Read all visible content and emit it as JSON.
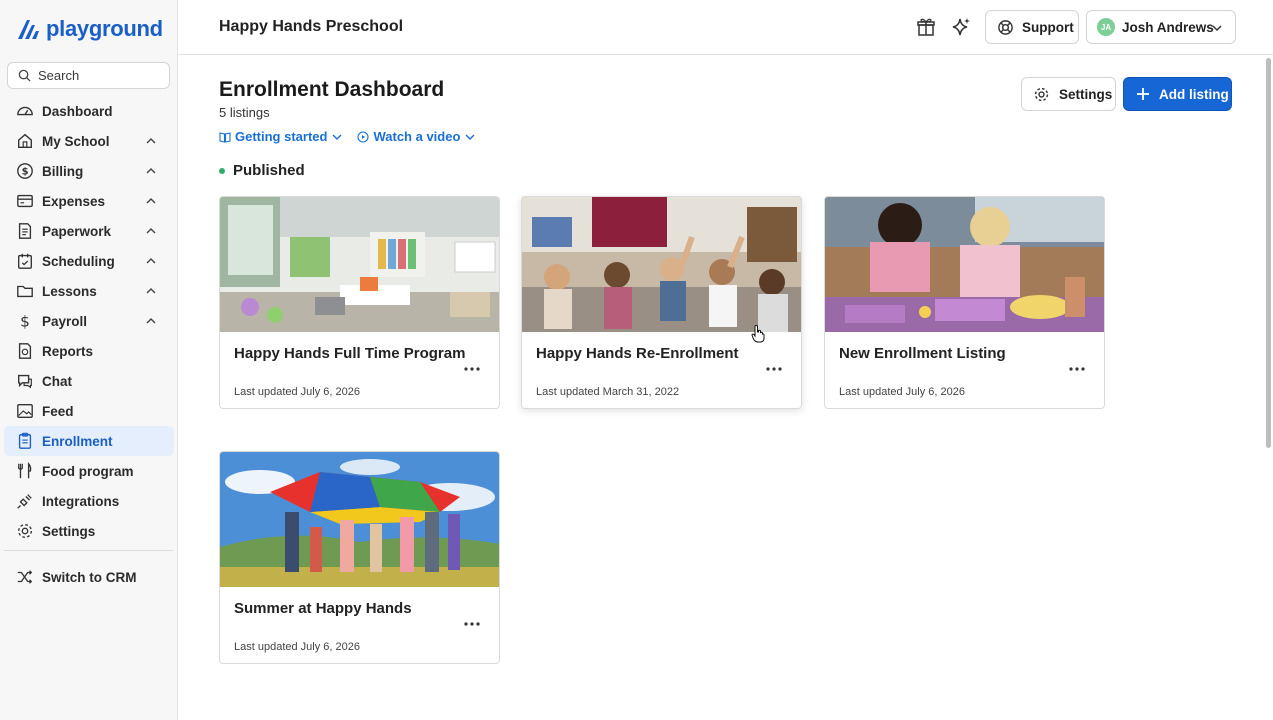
{
  "app": {
    "logo_text": "playground",
    "school_name": "Happy Hands Preschool"
  },
  "sidebar": {
    "search_placeholder": "Search",
    "items": [
      {
        "label": "Dashboard",
        "icon": "dashboard-icon",
        "expandable": false,
        "active": false
      },
      {
        "label": "My School",
        "icon": "home-icon",
        "expandable": true,
        "active": false
      },
      {
        "label": "Billing",
        "icon": "dollar-circle-icon",
        "expandable": true,
        "active": false
      },
      {
        "label": "Expenses",
        "icon": "card-icon",
        "expandable": true,
        "active": false
      },
      {
        "label": "Paperwork",
        "icon": "document-icon",
        "expandable": true,
        "active": false
      },
      {
        "label": "Scheduling",
        "icon": "calendar-icon",
        "expandable": true,
        "active": false
      },
      {
        "label": "Lessons",
        "icon": "folder-icon",
        "expandable": true,
        "active": false
      },
      {
        "label": "Payroll",
        "icon": "dollar-icon",
        "expandable": true,
        "active": false
      },
      {
        "label": "Reports",
        "icon": "report-icon",
        "expandable": false,
        "active": false
      },
      {
        "label": "Chat",
        "icon": "chat-icon",
        "expandable": false,
        "active": false
      },
      {
        "label": "Feed",
        "icon": "image-icon",
        "expandable": false,
        "active": false
      },
      {
        "label": "Enrollment",
        "icon": "clipboard-icon",
        "expandable": false,
        "active": true
      },
      {
        "label": "Food program",
        "icon": "utensils-icon",
        "expandable": false,
        "active": false
      },
      {
        "label": "Integrations",
        "icon": "plug-icon",
        "expandable": false,
        "active": false
      },
      {
        "label": "Settings",
        "icon": "gear-icon",
        "expandable": false,
        "active": false
      }
    ],
    "switch_label": "Switch to CRM"
  },
  "topbar": {
    "support_label": "Support",
    "user_name": "Josh Andrews",
    "user_initials": "JA"
  },
  "main": {
    "title": "Enrollment Dashboard",
    "listing_count": "5 listings",
    "links": [
      "Getting started",
      "Watch a video"
    ],
    "settings_label": "Settings",
    "add_label": "Add listing",
    "section_label": "Published",
    "cards": [
      {
        "title": "Happy Hands Full Time Program",
        "updated": "Last updated July 6, 2026",
        "image": "classroom"
      },
      {
        "title": "Happy Hands Re-Enrollment",
        "updated": "Last updated March 31, 2022",
        "image": "kids-circle"
      },
      {
        "title": "New Enrollment Listing",
        "updated": "Last updated July 6, 2026",
        "image": "playdough"
      },
      {
        "title": "Summer at Happy Hands",
        "updated": "Last updated July 6, 2026",
        "image": "parachute"
      }
    ]
  },
  "colors": {
    "brand": "#1a5fc9",
    "primary_button": "#1666d6",
    "active_nav_bg": "#e4eefc",
    "published_dot": "#2fae6a",
    "avatar": "#7dcf97"
  }
}
